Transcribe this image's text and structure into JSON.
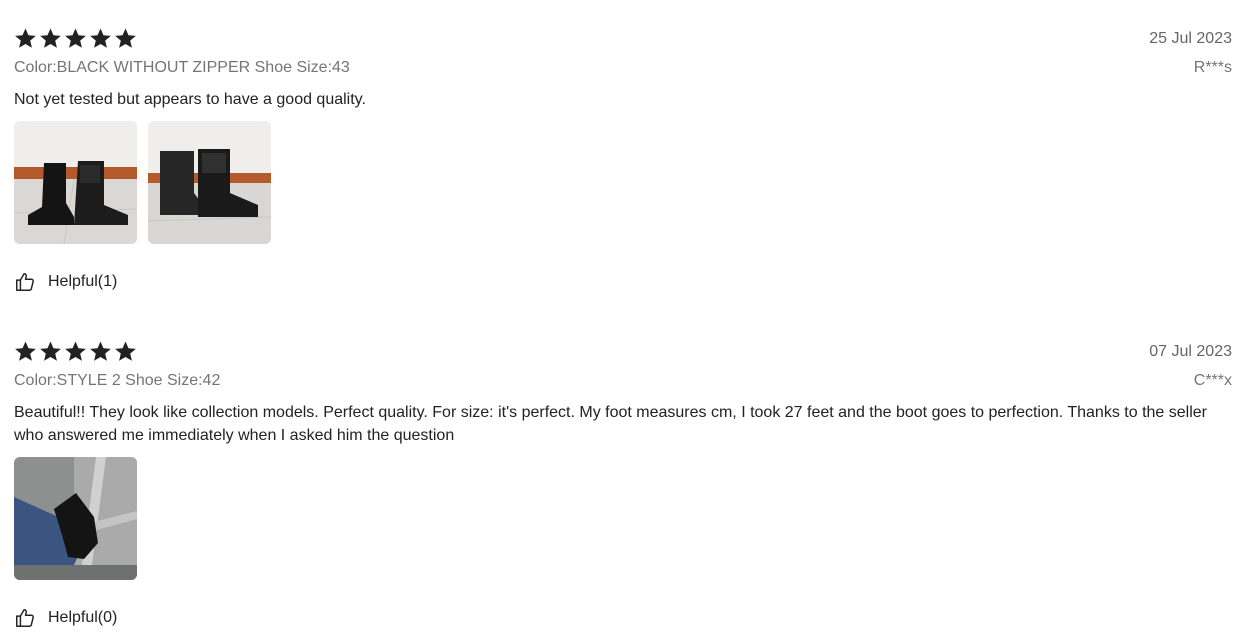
{
  "reviews": [
    {
      "rating": 5,
      "date": "25 Jul 2023",
      "sku": "Color:BLACK WITHOUT ZIPPER Shoe Size:43",
      "author": "R***s",
      "text": "Not yet tested but appears to have a good quality.",
      "images": [
        "black-boots-on-tile-floor",
        "black-boots-front-view"
      ],
      "helpful_label": "Helpful(1)"
    },
    {
      "rating": 5,
      "date": "07 Jul 2023",
      "sku": "Color:STYLE 2 Shoe Size:42",
      "author": "C***x",
      "text": "Beautiful!! They look like collection models. Perfect quality. For size: it's perfect. My foot measures cm, I took 27 feet and the boot goes to perfection. Thanks to the seller who answered me immediately when I asked him the question",
      "images": [
        "worn-boot-on-foot"
      ],
      "helpful_label": "Helpful(0)"
    }
  ],
  "icons": {
    "star": "star-icon",
    "helpful": "thumbs-up-icon"
  },
  "colors": {
    "star": "#222222",
    "meta_text": "#757575",
    "body_text": "#222222"
  }
}
